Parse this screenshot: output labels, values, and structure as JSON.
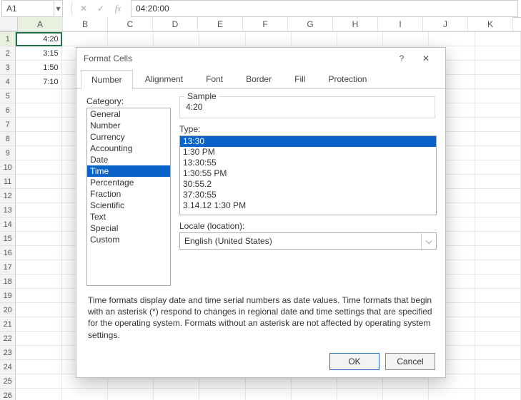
{
  "namebox": "A1",
  "formula": "04:20:00",
  "columns": [
    "A",
    "B",
    "C",
    "D",
    "E",
    "F",
    "G",
    "H",
    "I",
    "J",
    "K"
  ],
  "rowCount": 26,
  "cells": {
    "A1": "4:20",
    "A2": "3:15",
    "A3": "1:50",
    "A4": "7:10"
  },
  "activeCell": "A1",
  "dialog": {
    "title": "Format Cells",
    "tabs": [
      "Number",
      "Alignment",
      "Font",
      "Border",
      "Fill",
      "Protection"
    ],
    "activeTab": "Number",
    "categoryLabel": "Category:",
    "categories": [
      "General",
      "Number",
      "Currency",
      "Accounting",
      "Date",
      "Time",
      "Percentage",
      "Fraction",
      "Scientific",
      "Text",
      "Special",
      "Custom"
    ],
    "selectedCategory": "Time",
    "sampleLabel": "Sample",
    "sampleValue": "4:20",
    "typeLabel": "Type:",
    "types": [
      "13:30",
      "1:30 PM",
      "13:30:55",
      "1:30:55 PM",
      "30:55.2",
      "37:30:55",
      "3.14.12 1:30 PM"
    ],
    "selectedType": "13:30",
    "localeLabel": "Locale (location):",
    "localeValue": "English (United States)",
    "description": "Time formats display date and time serial numbers as date values.  Time formats that begin with an asterisk (*) respond to changes in regional date and time settings that are specified for the operating system. Formats without an asterisk are not affected by operating system settings.",
    "ok": "OK",
    "cancel": "Cancel"
  }
}
